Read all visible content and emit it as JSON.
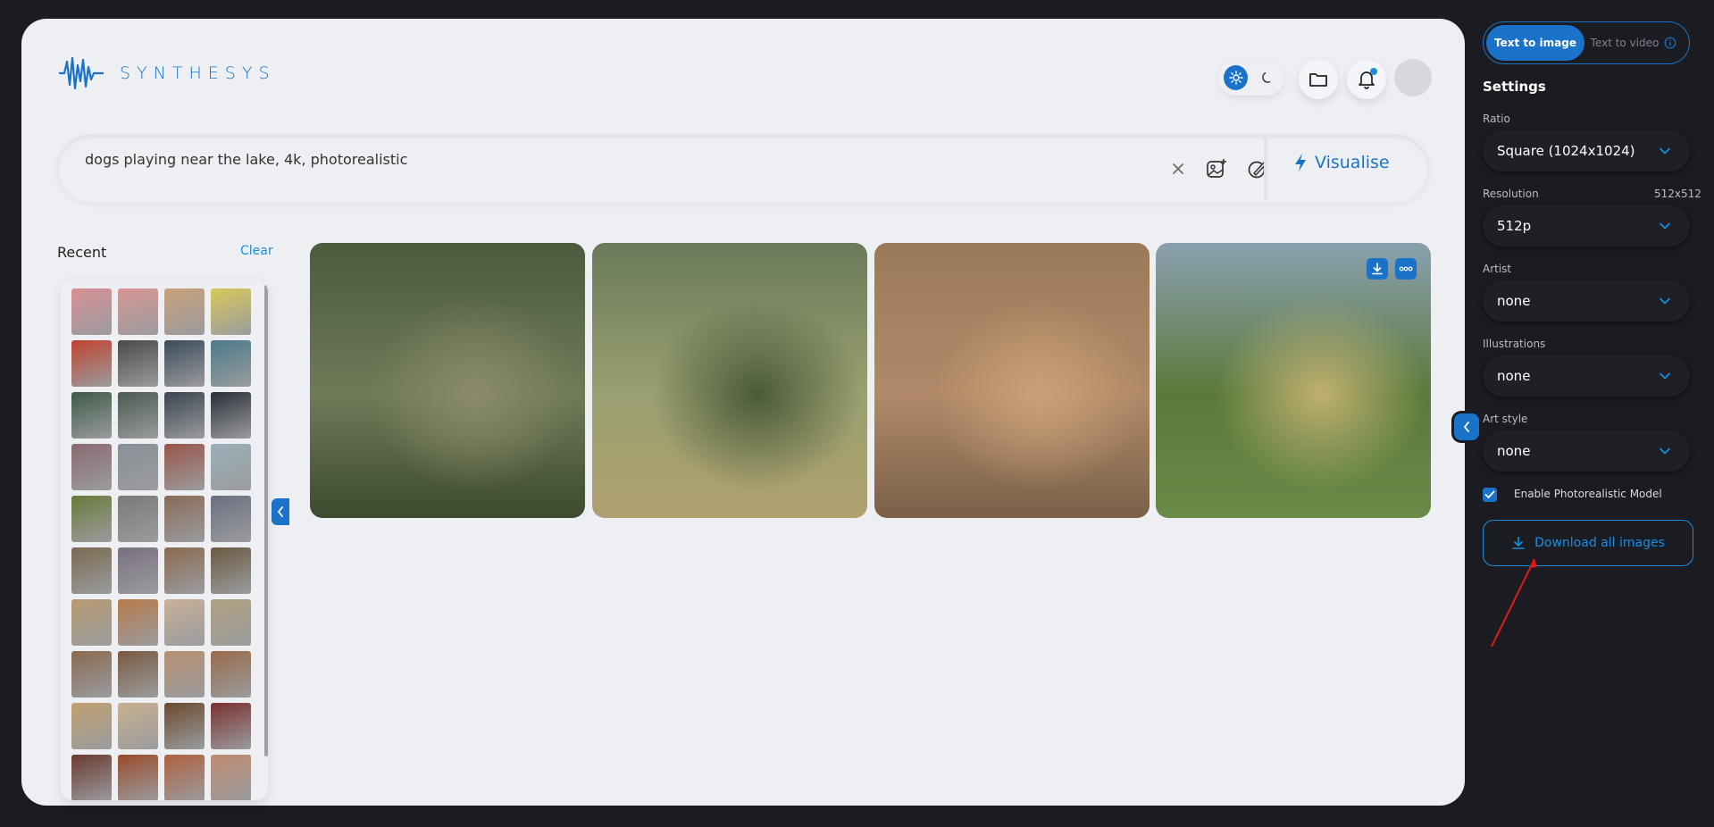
{
  "brand": {
    "name": "SYNTHESYS"
  },
  "prompt": {
    "text": "dogs playing near the lake, 4k, photorealistic",
    "visualise_label": "Visualise"
  },
  "recent": {
    "title": "Recent",
    "clear_label": "Clear",
    "thumb_colors": [
      "#d98f96",
      "#d89693",
      "#c9a07a",
      "#d9c85a",
      "#c0432e",
      "#4a4a4a",
      "#3b4a5a",
      "#4a7a8a",
      "#3d5a48",
      "#4a5a50",
      "#3a4450",
      "#2a3038",
      "#8a6a70",
      "#8a9098",
      "#9a5548",
      "#9ab0b8",
      "#6a7a3a",
      "#7a7a78",
      "#8a6a58",
      "#6a7080",
      "#7a6a50",
      "#7a7080",
      "#8a6a50",
      "#6a5a40",
      "#b89a70",
      "#b87a4a",
      "#c8b098",
      "#b0a080",
      "#8a6a50",
      "#7a5a40",
      "#b89070",
      "#9a6a4a",
      "#c0a070",
      "#c8b090",
      "#6a4a30",
      "#7a3030",
      "#6a3a30",
      "#9a4a2a",
      "#b06040",
      "#c08a70"
    ]
  },
  "images": [
    {
      "colors": [
        "#4c5a3e",
        "#6e7a58",
        "#8a8a6a",
        "#3e4a2e"
      ]
    },
    {
      "colors": [
        "#6a7a5a",
        "#9aa070",
        "#4a5a38",
        "#b0a070"
      ]
    },
    {
      "colors": [
        "#9a7a58",
        "#b08a68",
        "#c8a078",
        "#7a6048"
      ]
    },
    {
      "colors": [
        "#8aa0b0",
        "#5a7a3a",
        "#c0b070",
        "#6a8a48"
      ]
    }
  ],
  "sidebar": {
    "mode_tabs": [
      "Text to image",
      "Text to video"
    ],
    "heading": "Settings",
    "fields": [
      {
        "label": "Ratio",
        "meta": "",
        "value": "Square (1024x1024)"
      },
      {
        "label": "Resolution",
        "meta": "512x512",
        "value": "512p"
      },
      {
        "label": "Artist",
        "meta": "",
        "value": "none"
      },
      {
        "label": "Illustrations",
        "meta": "",
        "value": "none"
      },
      {
        "label": "Art style",
        "meta": "",
        "value": "none"
      }
    ],
    "photoreal_label": "Enable Photorealistic Model",
    "photoreal_checked": true,
    "download_label": "Download all images"
  },
  "colors": {
    "accent": "#1a73c8",
    "accent_light": "#1a8de0",
    "annotation": "#e0191b"
  }
}
